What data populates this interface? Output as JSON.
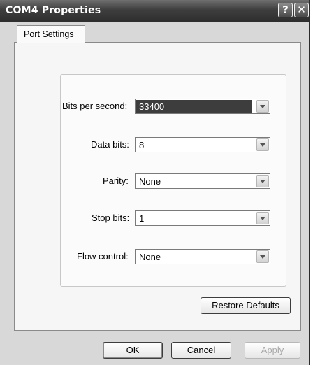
{
  "window": {
    "title": "COM4 Properties",
    "help_glyph": "?",
    "close_glyph": "✕"
  },
  "tabs": [
    {
      "label": "Port Settings",
      "active": true
    }
  ],
  "fields": {
    "bits_per_second": {
      "label": "Bits per second:",
      "value": "33400"
    },
    "data_bits": {
      "label": "Data bits:",
      "value": "8"
    },
    "parity": {
      "label": "Parity:",
      "value": "None"
    },
    "stop_bits": {
      "label": "Stop bits:",
      "value": "1"
    },
    "flow_control": {
      "label": "Flow control:",
      "value": "None"
    }
  },
  "buttons": {
    "restore_defaults": "Restore Defaults",
    "ok": "OK",
    "cancel": "Cancel",
    "apply": "Apply"
  }
}
